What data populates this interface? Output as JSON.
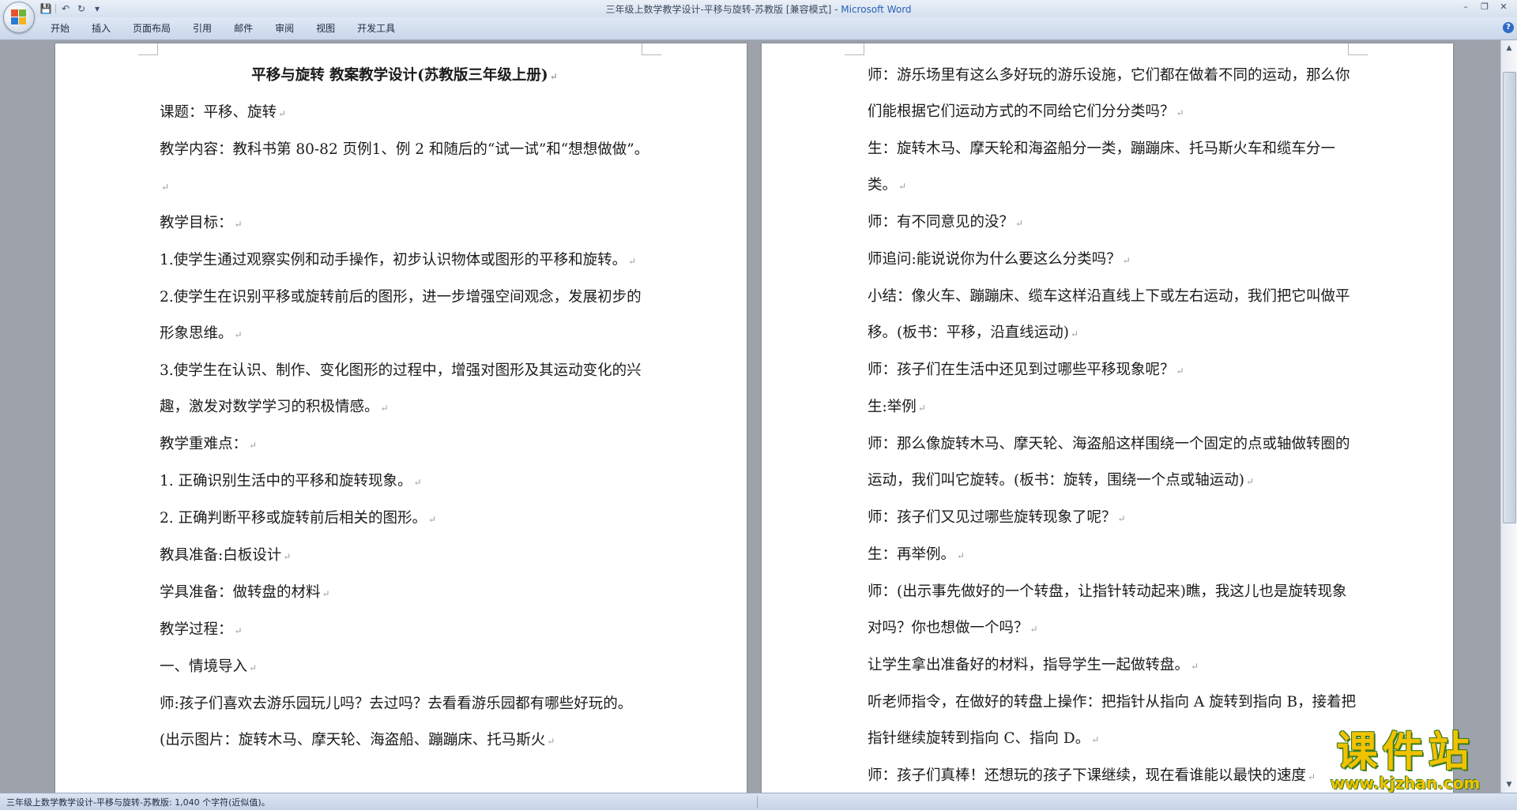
{
  "window": {
    "title": "三年级上数学教学设计-平移与旋转-苏教版 [兼容模式]",
    "title_sep": " - ",
    "app_name": "Microsoft Word",
    "minimize": "–",
    "restore": "❐",
    "close": "✕"
  },
  "qat": {
    "save_icon": "💾",
    "undo_icon": "↶",
    "redo_icon": "↻",
    "more_icon": "▾"
  },
  "ribbon": {
    "tabs": [
      "开始",
      "插入",
      "页面布局",
      "引用",
      "邮件",
      "审阅",
      "视图",
      "开发工具"
    ],
    "help_icon": "?"
  },
  "page_left": {
    "title": "平移与旋转  教案教学设计(苏教版三年级上册)",
    "lines": [
      "课题：平移、旋转",
      "教学内容：教科书第 80-82 页例1、例 2 和随后的“试一试”和“想想做做”。",
      "教学目标：",
      "1.使学生通过观察实例和动手操作，初步认识物体或图形的平移和旋转。",
      "2.使学生在识别平移或旋转前后的图形，进一步增强空间观念，发展初步的形象思维。",
      "3.使学生在认识、制作、变化图形的过程中，增强对图形及其运动变化的兴趣，激发对数学学习的积极情感。",
      "教学重难点：",
      "1.  正确识别生活中的平移和旋转现象。",
      "2.  正确判断平移或旋转前后相关的图形。",
      "教具准备:白板设计",
      "学具准备：做转盘的材料",
      "教学过程：",
      "一、情境导入",
      "师:孩子们喜欢去游乐园玩儿吗？去过吗？去看看游乐园都有哪些好玩的。(出示图片：旋转木马、摩天轮、海盗船、蹦蹦床、托马斯火"
    ]
  },
  "page_right": {
    "lines": [
      "师：游乐场里有这么多好玩的游乐设施，它们都在做着不同的运动，那么你们能根据它们运动方式的不同给它们分分类吗？",
      "生：旋转木马、摩天轮和海盗船分一类，蹦蹦床、托马斯火车和缆车分一类。",
      "师：有不同意见的没？",
      "师追问:能说说你为什么要这么分类吗？",
      "小结：像火车、蹦蹦床、缆车这样沿直线上下或左右运动，我们把它叫做平移。(板书：平移，沿直线运动)",
      "师：孩子们在生活中还见到过哪些平移现象呢？",
      "生:举例",
      "师：那么像旋转木马、摩天轮、海盗船这样围绕一个固定的点或轴做转圈的运动，我们叫它旋转。(板书：旋转，围绕一个点或轴运动)",
      "师：孩子们又见过哪些旋转现象了呢？",
      "生：再举例。",
      "师：(出示事先做好的一个转盘，让指针转动起来)瞧，我这儿也是旋转现象对吗？你也想做一个吗？",
      "让学生拿出准备好的材料，指导学生一起做转盘。",
      "听老师指令，在做好的转盘上操作：把指针从指向 A 旋转到指向 B，接着把指针继续旋转到指向 C、指向 D。",
      "师：孩子们真棒！还想玩的孩子下课继续，现在看谁能以最快的速度"
    ]
  },
  "paragraph_mark": "↵",
  "statusbar": {
    "text": "三年级上数学教学设计-平移与旋转-苏教版: 1,040 个字符(近似值)。"
  },
  "watermark": {
    "title": "课件站",
    "url": "www.kjzhan.com"
  },
  "scrollbar": {
    "up": "▲",
    "down": "▼"
  }
}
